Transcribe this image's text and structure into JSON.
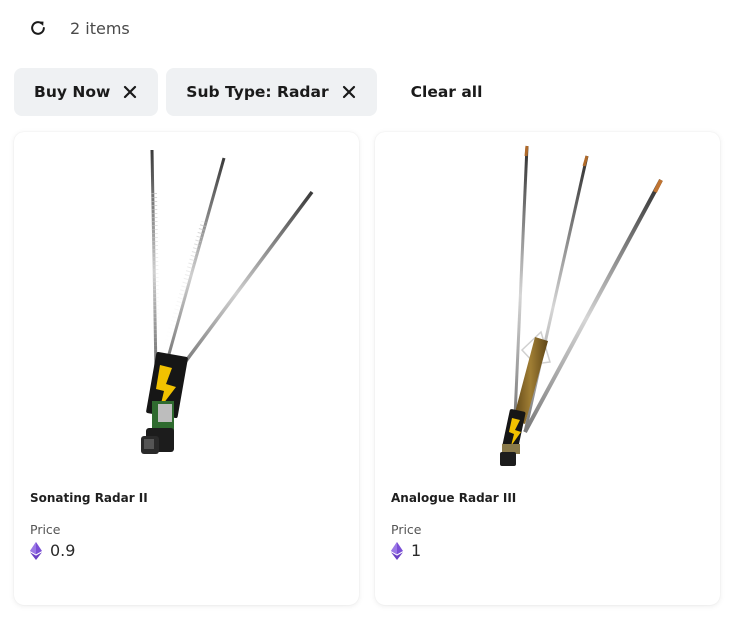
{
  "toolbar": {
    "refresh_icon": "refresh-icon",
    "items_count": "2 items"
  },
  "filters": {
    "chips": [
      {
        "label": "Buy Now",
        "icon": "close-icon"
      },
      {
        "label": "Sub Type: Radar",
        "icon": "close-icon"
      }
    ],
    "clear_all_label": "Clear all"
  },
  "colors": {
    "chip_background": "#eff1f3",
    "eth_purple": "#7b4fd6",
    "accent_yellow": "#f2c200",
    "accent_green": "#2f6b2f",
    "wood_brown": "#8a6a26"
  },
  "items": [
    {
      "name": "Sonating Radar II",
      "price_label": "Price",
      "price_value": "0.9",
      "currency_icon": "ethereum-icon"
    },
    {
      "name": "Analogue Radar III",
      "price_label": "Price",
      "price_value": "1",
      "currency_icon": "ethereum-icon"
    }
  ]
}
